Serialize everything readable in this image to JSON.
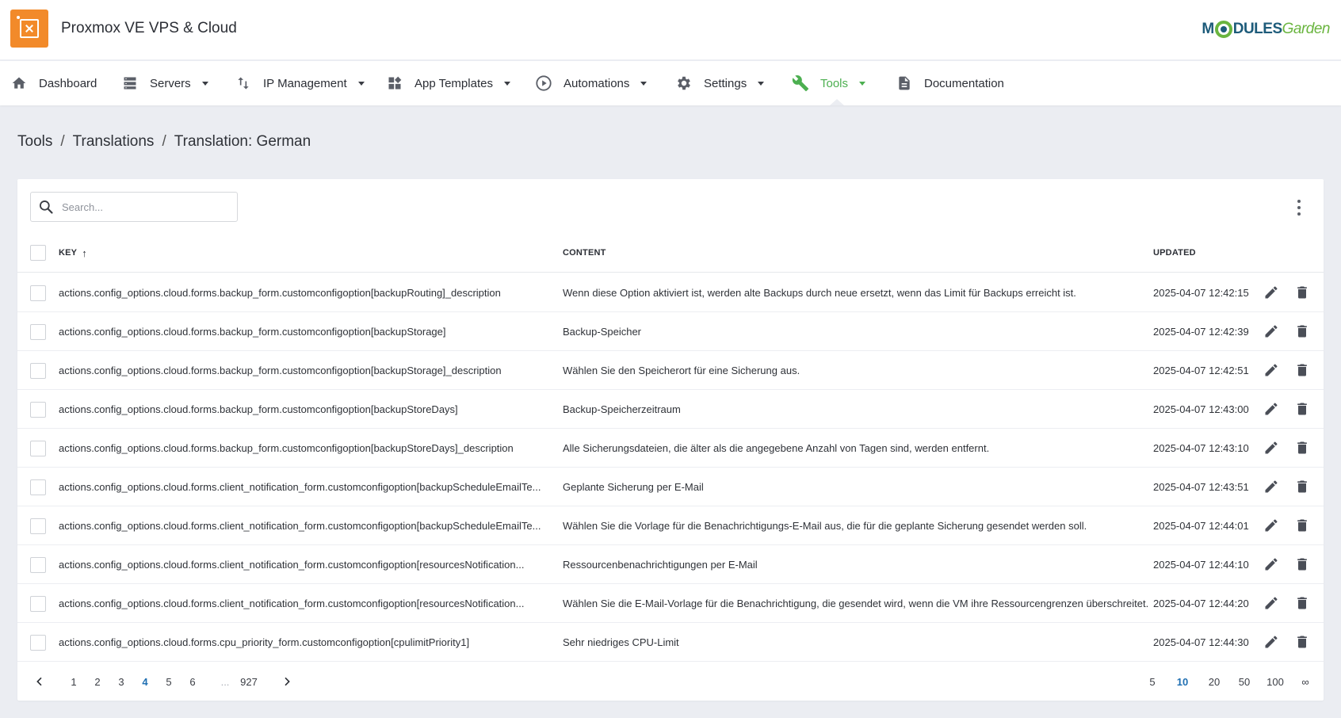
{
  "app": {
    "title": "Proxmox VE VPS & Cloud",
    "brand_part1": "M",
    "brand_part2": "DULES",
    "brand_part3": "Garden"
  },
  "nav": [
    {
      "label": "Dashboard",
      "icon": "home-icon",
      "dropdown": false,
      "active": false
    },
    {
      "label": "Servers",
      "icon": "server-icon",
      "dropdown": true,
      "active": false
    },
    {
      "label": "IP Management",
      "icon": "ip-arrows-icon",
      "dropdown": true,
      "active": false
    },
    {
      "label": "App Templates",
      "icon": "apps-icon",
      "dropdown": true,
      "active": false
    },
    {
      "label": "Automations",
      "icon": "play-circle-icon",
      "dropdown": true,
      "active": false
    },
    {
      "label": "Settings",
      "icon": "gear-icon",
      "dropdown": true,
      "active": false
    },
    {
      "label": "Tools",
      "icon": "wrench-icon",
      "dropdown": true,
      "active": true
    },
    {
      "label": "Documentation",
      "icon": "document-icon",
      "dropdown": false,
      "active": false
    }
  ],
  "breadcrumb": [
    "Tools",
    "Translations",
    "Translation: German"
  ],
  "search": {
    "placeholder": "Search..."
  },
  "table": {
    "columns": {
      "key": "KEY",
      "content": "CONTENT",
      "updated": "UPDATED"
    },
    "sort": {
      "column": "key",
      "direction": "asc"
    },
    "rows": [
      {
        "key": "actions.config_options.cloud.forms.backup_form.customconfigoption[backupRouting]_description",
        "content": "Wenn diese Option aktiviert ist, werden alte Backups durch neue ersetzt, wenn das Limit für Backups erreicht ist.",
        "updated": "2025-04-07 12:42:15"
      },
      {
        "key": "actions.config_options.cloud.forms.backup_form.customconfigoption[backupStorage]",
        "content": "Backup-Speicher",
        "updated": "2025-04-07 12:42:39"
      },
      {
        "key": "actions.config_options.cloud.forms.backup_form.customconfigoption[backupStorage]_description",
        "content": "Wählen Sie den Speicherort für eine Sicherung aus.",
        "updated": "2025-04-07 12:42:51"
      },
      {
        "key": "actions.config_options.cloud.forms.backup_form.customconfigoption[backupStoreDays]",
        "content": "Backup-Speicherzeitraum",
        "updated": "2025-04-07 12:43:00"
      },
      {
        "key": "actions.config_options.cloud.forms.backup_form.customconfigoption[backupStoreDays]_description",
        "content": "Alle Sicherungsdateien, die älter als die angegebene Anzahl von Tagen sind, werden entfernt.",
        "updated": "2025-04-07 12:43:10"
      },
      {
        "key": "actions.config_options.cloud.forms.client_notification_form.customconfigoption[backupScheduleEmailTe...",
        "content": "Geplante Sicherung per E-Mail",
        "updated": "2025-04-07 12:43:51"
      },
      {
        "key": "actions.config_options.cloud.forms.client_notification_form.customconfigoption[backupScheduleEmailTe...",
        "content": "Wählen Sie die Vorlage für die Benachrichtigungs-E-Mail aus, die für die geplante Sicherung gesendet werden soll.",
        "updated": "2025-04-07 12:44:01"
      },
      {
        "key": "actions.config_options.cloud.forms.client_notification_form.customconfigoption[resourcesNotification...",
        "content": "Ressourcenbenachrichtigungen per E-Mail",
        "updated": "2025-04-07 12:44:10"
      },
      {
        "key": "actions.config_options.cloud.forms.client_notification_form.customconfigoption[resourcesNotification...",
        "content": "Wählen Sie die E-Mail-Vorlage für die Benachrichtigung, die gesendet wird, wenn die VM ihre Ressourcengrenzen überschreitet.",
        "updated": "2025-04-07 12:44:20"
      },
      {
        "key": "actions.config_options.cloud.forms.cpu_priority_form.customconfigoption[cpulimitPriority1]",
        "content": "Sehr niedriges CPU-Limit",
        "updated": "2025-04-07 12:44:30"
      }
    ]
  },
  "pagination": {
    "pages": [
      "1",
      "2",
      "3",
      "4",
      "5",
      "6",
      "...",
      "927"
    ],
    "current": "4",
    "per_page_options": [
      "5",
      "10",
      "20",
      "50",
      "100",
      "∞"
    ],
    "per_page_current": "10"
  },
  "colors": {
    "accent_green": "#4caf50",
    "logo_orange": "#f28a2a",
    "active_page_blue": "#1f6fb2",
    "page_bg": "#ebedf2"
  }
}
